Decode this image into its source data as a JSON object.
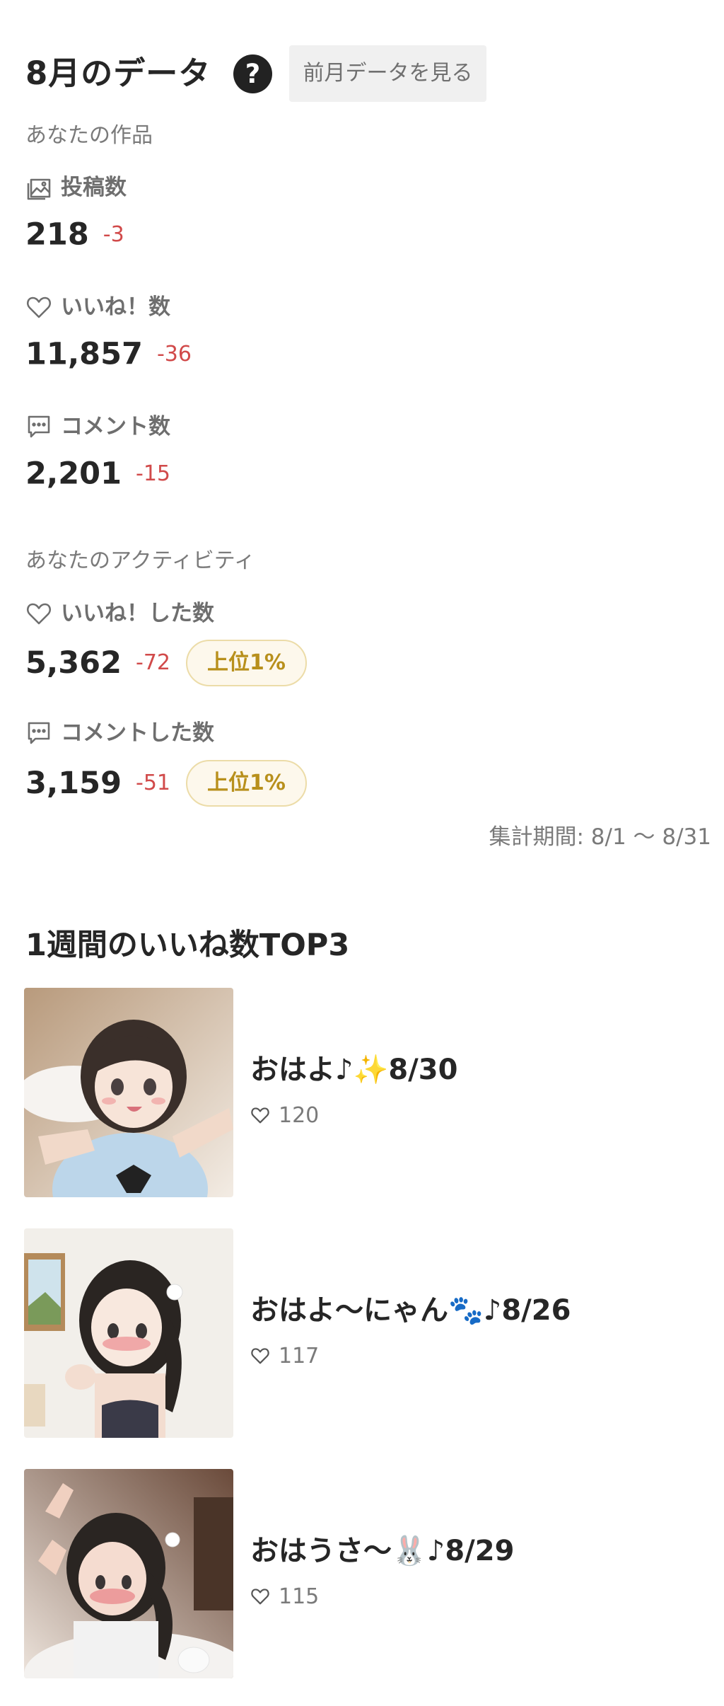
{
  "header": {
    "title": "8月のデータ",
    "help_icon": "?",
    "prev_month_button": "前月データを見る"
  },
  "your_works": {
    "section_label": "あなたの作品",
    "metrics": [
      {
        "icon": "gallery-icon",
        "label": "投稿数",
        "value": "218",
        "delta": "-3"
      },
      {
        "icon": "heart-icon",
        "label": "いいね！数",
        "value": "11,857",
        "delta": "-36"
      },
      {
        "icon": "comment-icon",
        "label": "コメント数",
        "value": "2,201",
        "delta": "-15"
      }
    ]
  },
  "your_activity": {
    "section_label": "あなたのアクティビティ",
    "metrics": [
      {
        "icon": "heart-icon",
        "label": "いいね！した数",
        "value": "5,362",
        "delta": "-72",
        "badge": "上位1%"
      },
      {
        "icon": "comment-icon",
        "label": "コメントした数",
        "value": "3,159",
        "delta": "-51",
        "badge": "上位1%"
      }
    ]
  },
  "period": "集計期間: 8/1 ～ 8/31",
  "top_likes": {
    "title": "1週間のいいね数TOP3",
    "posts": [
      {
        "title": "おはよ♪✨8/30",
        "likes": "120"
      },
      {
        "title": "おはよ〜にゃん🐾♪8/26",
        "likes": "117"
      },
      {
        "title": "おはうさ〜🐰♪8/29",
        "likes": "115"
      }
    ]
  },
  "colors": {
    "text": "#262626",
    "muted": "#7a7a7a",
    "delta_negative": "#d14a4a",
    "badge_text": "#b8901c",
    "badge_border": "#ecdca8",
    "badge_bg": "#fdf8ec",
    "button_bg": "#f0f0f0"
  }
}
